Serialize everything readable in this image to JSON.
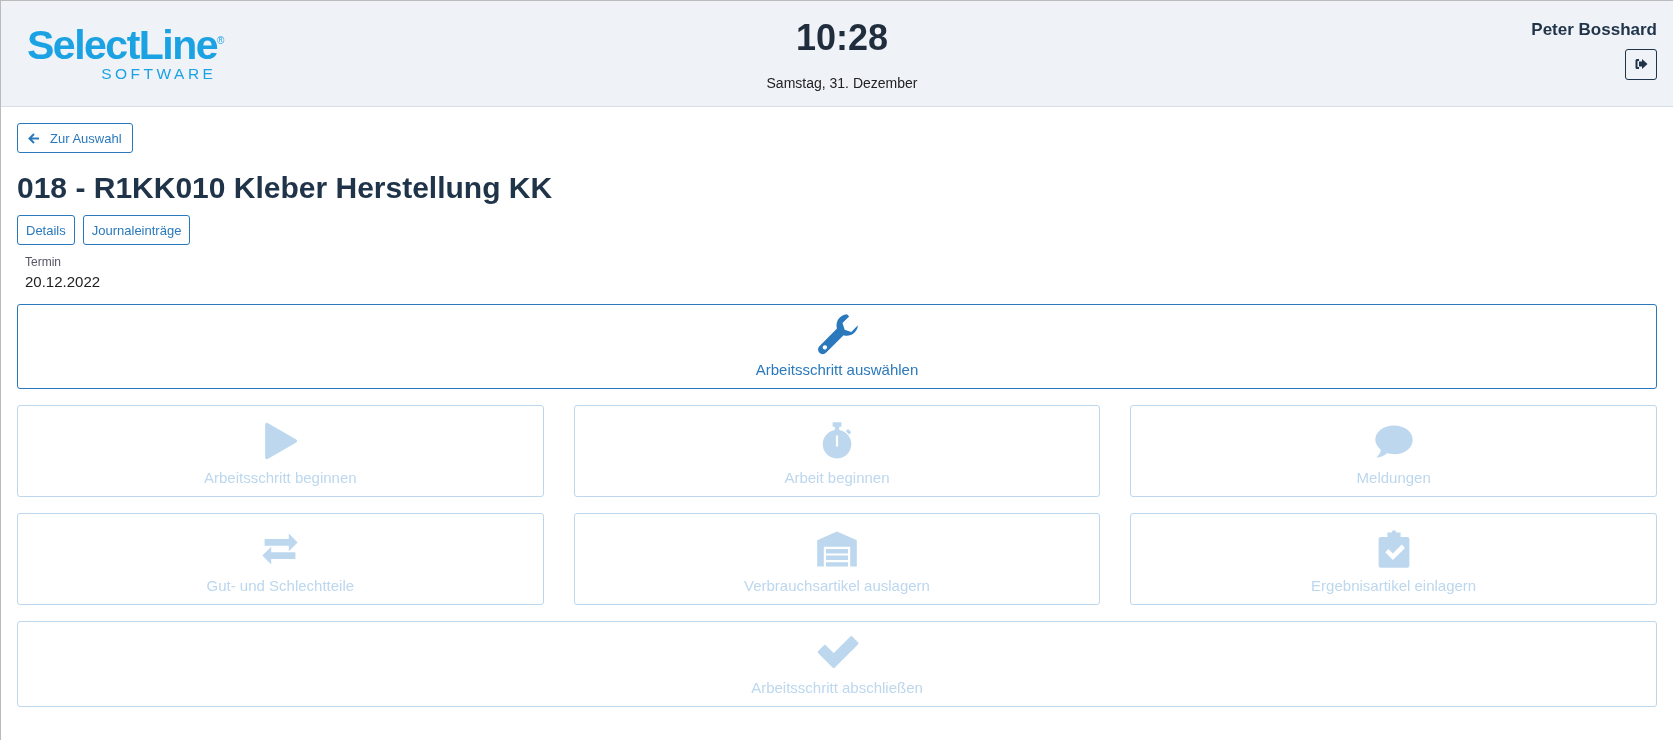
{
  "header": {
    "logo": "SelectLine$^{®}$",
    "logo_sub": "SOFTWARE",
    "time": "10:28",
    "date": "Samstag, 31. Dezember",
    "user": "Peter Bosshard"
  },
  "back_button": "Zur Auswahl",
  "title": "018 - R1KK010 Kleber Herstellung KK",
  "tabs": [
    {
      "label": "Details"
    },
    {
      "label": "Journaleinträge"
    }
  ],
  "termin": {
    "label": "Termin",
    "value": "20.12.2022"
  },
  "top_action": {
    "label": "Arbeitsschritt auswählen",
    "kind": "wrench",
    "disabled": false
  },
  "actions": [
    {
      "label": "Arbeitsschritt beginnen",
      "kind": "play",
      "disabled": true
    },
    {
      "label": "Arbeit beginnen",
      "kind": "stopwatch",
      "disabled": true
    },
    {
      "label": "Meldungen",
      "kind": "comment",
      "disabled": true
    },
    {
      "label": "Gut- und Schlechtteile",
      "kind": "exchange",
      "disabled": true
    },
    {
      "label": "Verbrauchsartikel auslagern",
      "kind": "warehouse",
      "disabled": true
    },
    {
      "label": "Ergebnisartikel einlagern",
      "kind": "clipboard",
      "disabled": true
    }
  ],
  "bottom_action": {
    "label": "Arbeitsschritt abschließen",
    "kind": "check",
    "disabled": true
  }
}
